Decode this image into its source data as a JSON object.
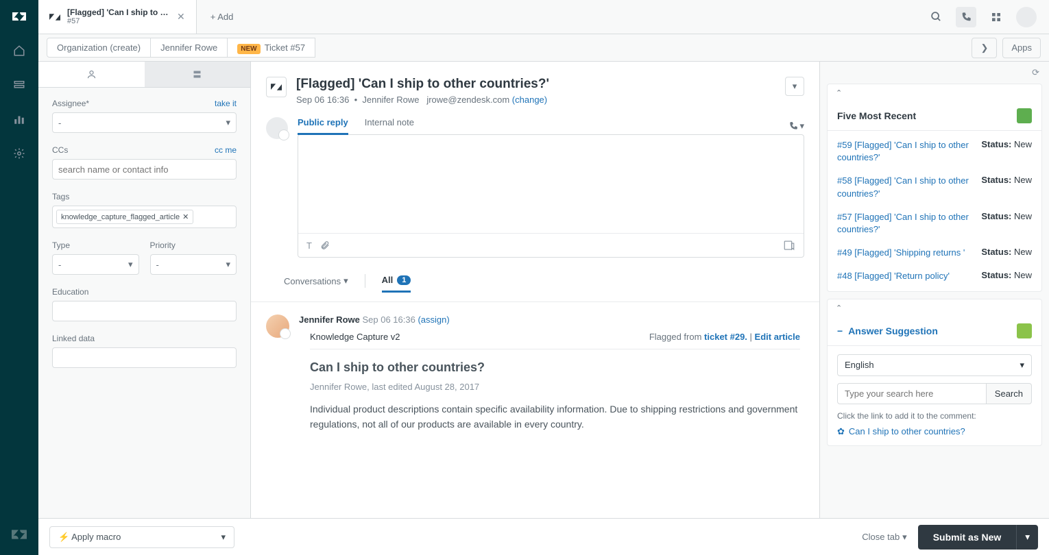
{
  "tab": {
    "title": "[Flagged] 'Can I ship to o...",
    "sub": "#57",
    "add": "+ Add"
  },
  "topicons": {
    "search": "search",
    "phone": "phone",
    "apps": "apps"
  },
  "crumbs": {
    "org": "Organization (create)",
    "user": "Jennifer Rowe",
    "badge": "NEW",
    "ticket": "Ticket #57",
    "expand": "❯",
    "apps": "Apps"
  },
  "left": {
    "assignee_label": "Assignee*",
    "takeit": "take it",
    "assignee_val": "-",
    "ccs_label": "CCs",
    "ccme": "cc me",
    "ccs_ph": "search name or contact info",
    "tags_label": "Tags",
    "tag": "knowledge_capture_flagged_article",
    "type_label": "Type",
    "type_val": "-",
    "priority_label": "Priority",
    "priority_val": "-",
    "education_label": "Education",
    "linked_label": "Linked data"
  },
  "ticket": {
    "title": "[Flagged] 'Can I ship to other countries?'",
    "date": "Sep 06 16:36",
    "author": "Jennifer Rowe",
    "email": "jrowe@zendesk.com",
    "change": "(change)"
  },
  "reply": {
    "public": "Public reply",
    "internal": "Internal note"
  },
  "conv": {
    "label": "Conversations",
    "all": "All",
    "count": "1"
  },
  "event": {
    "author": "Jennifer Rowe",
    "ts": "Sep 06 16:36",
    "assign": "(assign)",
    "kc": "Knowledge Capture v2",
    "flagged_pre": "Flagged from ",
    "flagged_link": "ticket #29.",
    "sep": " | ",
    "edit": "Edit article",
    "article_title": "Can I ship to other countries?",
    "article_meta": "Jennifer Rowe, last edited August 28, 2017",
    "article_body": "Individual product descriptions contain specific availability information. Due to shipping restrictions and government regulations, not all of our products are available in every country."
  },
  "right": {
    "recent_title": "Five Most Recent",
    "items": [
      {
        "link": "#59 [Flagged] 'Can I ship to other countries?'",
        "status": "New"
      },
      {
        "link": "#58 [Flagged] 'Can I ship to other countries?'",
        "status": "New"
      },
      {
        "link": "#57 [Flagged] 'Can I ship to other countries?'",
        "status": "New"
      },
      {
        "link": "#49 [Flagged] 'Shipping returns '",
        "status": "New"
      },
      {
        "link": "#48 [Flagged] 'Return policy'",
        "status": "New"
      }
    ],
    "status_label": "Status: ",
    "answer_title": "Answer Suggestion",
    "minus": "−",
    "lang": "English",
    "search_ph": "Type your search here",
    "search_btn": "Search",
    "hint": "Click the link to add it to the comment:",
    "sug": "Can I ship to other countries?"
  },
  "footer": {
    "macro": "Apply macro",
    "close": "Close tab",
    "submit": "Submit as New"
  }
}
